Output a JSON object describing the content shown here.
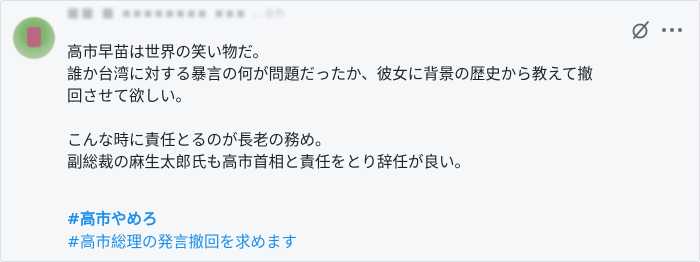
{
  "post": {
    "username": "■■ ■ ▪▪▪▪▪▪▪▪ ▪▪▪ ..on",
    "lines": [
      "高市早苗は世界の笑い物だ。",
      "誰か台湾に対する暴言の何が問題だったか、彼女に背景の歴史から教えて撤",
      "回させて欲しい。",
      "こんな時に責任とるのが長老の務め。",
      "副総裁の麻生太郎氏も高市首相と責任をとり辞任が良い。"
    ],
    "hashtags": [
      "#高市やめろ",
      "#高市総理の発言撤回を求めます"
    ]
  },
  "icons": {
    "translate": "translate-icon",
    "more": "more-icon"
  },
  "colors": {
    "hashtag": "#1d8fe8",
    "text": "#1f2328",
    "background": "#f5f7f9"
  }
}
